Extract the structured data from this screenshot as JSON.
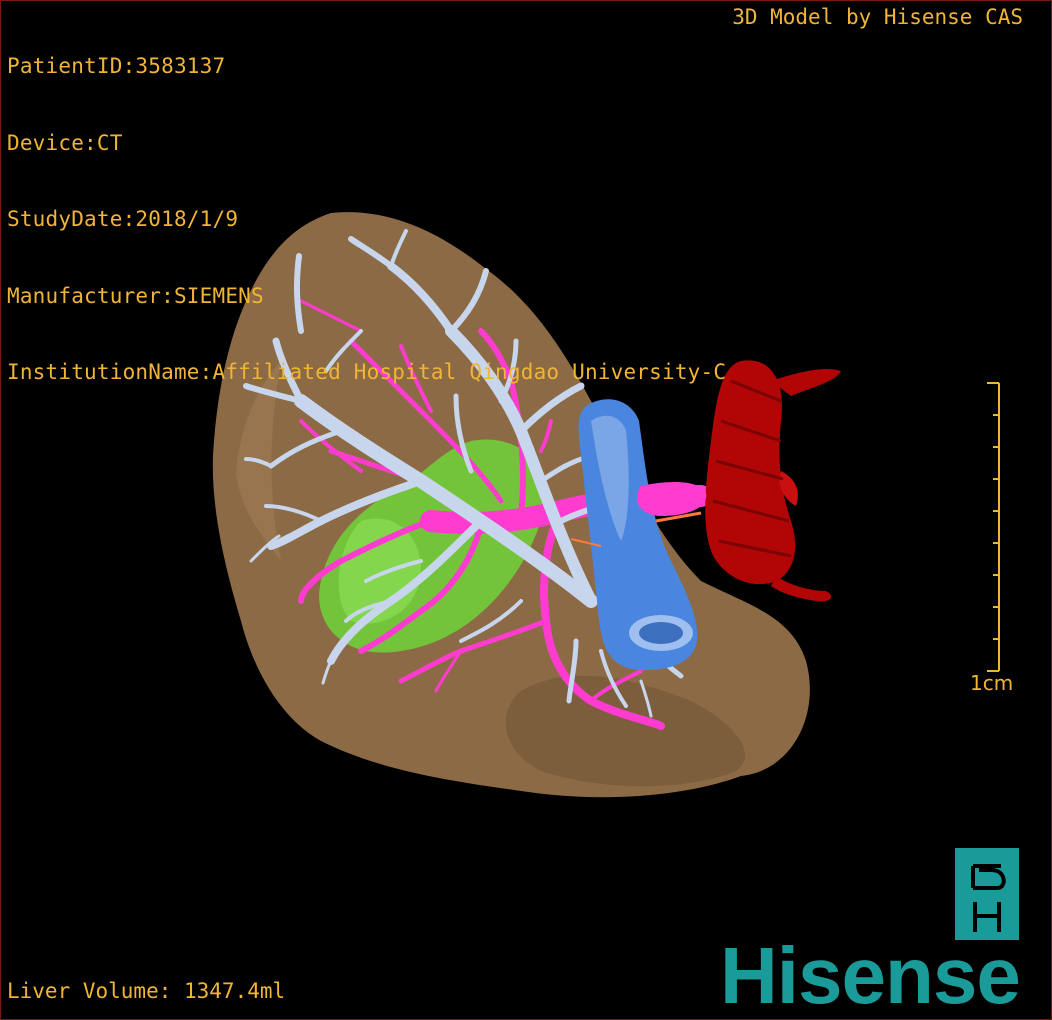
{
  "overlay": {
    "patient_id": "PatientID:3583137",
    "device": "Device:CT",
    "study_date": "StudyDate:2018/1/9",
    "manufacturer": "Manufacturer:SIEMENS",
    "institution": "InstitutionName:Affiliated Hospital Qingdao University-C",
    "brand_top": "3D Model by Hisense CAS",
    "liver_volume": "Liver Volume: 1347.4ml"
  },
  "scale": {
    "label": "1cm"
  },
  "logo": {
    "text": "Hisense"
  },
  "colors": {
    "overlay_text": "#f0b536",
    "liver": "#8c6a45",
    "portal_vein": "#c7d6ec",
    "hepatic_artery": "#ff3ccf",
    "gallbladder": "#6fd43a",
    "ivc": "#4a86e0",
    "aorta": "#b20606",
    "brand": "#1a9b9a"
  }
}
